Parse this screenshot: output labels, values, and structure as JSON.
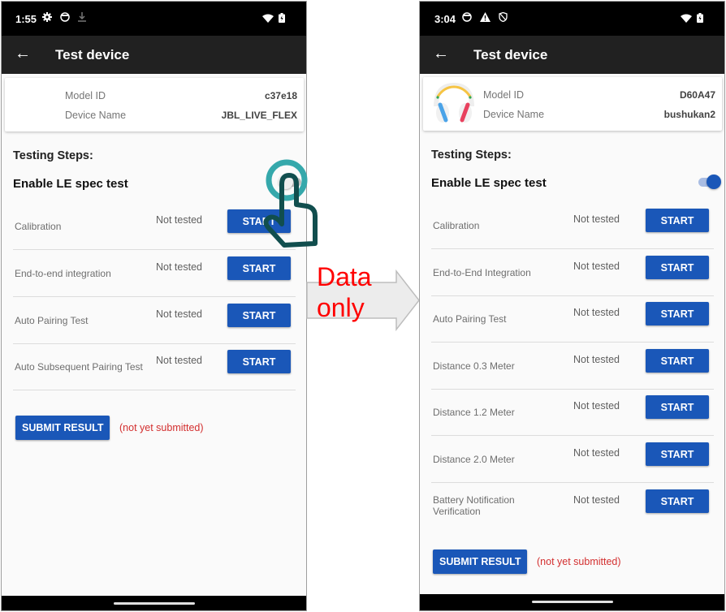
{
  "left_screen": {
    "status_bar": {
      "time": "1:55",
      "left_icons": [
        "settings-icon",
        "notification-app-icon",
        "download-icon"
      ],
      "right_icons": [
        "wifi-icon",
        "battery-charging-icon"
      ]
    },
    "app_bar": {
      "title": "Test device",
      "back_icon": "arrow-back-icon"
    },
    "device_card": {
      "model_id_label": "Model ID",
      "model_id_value": "c37e18",
      "device_name_label": "Device Name",
      "device_name_value": "JBL_LIVE_FLEX"
    },
    "section_title": "Testing Steps:",
    "le_spec_label": "Enable LE spec test",
    "le_spec_enabled": false,
    "tests": [
      {
        "name": "Calibration",
        "status": "Not tested",
        "button": "START"
      },
      {
        "name": "End-to-end integration",
        "status": "Not tested",
        "button": "START"
      },
      {
        "name": "Auto Pairing Test",
        "status": "Not tested",
        "button": "START"
      },
      {
        "name": "Auto Subsequent Pairing Test",
        "status": "Not tested",
        "button": "START"
      }
    ],
    "submit_button": "SUBMIT RESULT",
    "submit_status": "(not yet submitted)"
  },
  "annotation": {
    "arrow_text_line1": "Data",
    "arrow_text_line2": "only",
    "text_color": "#ff0000",
    "tap_indicator": "tap-hand-icon"
  },
  "right_screen": {
    "status_bar": {
      "time": "3:04",
      "left_icons": [
        "notification-app-icon",
        "warning-icon",
        "shield-icon"
      ],
      "right_icons": [
        "wifi-icon",
        "battery-charging-icon"
      ]
    },
    "app_bar": {
      "title": "Test device",
      "back_icon": "arrow-back-icon"
    },
    "device_card": {
      "image": "headphones-icon",
      "model_id_label": "Model ID",
      "model_id_value": "D60A47",
      "device_name_label": "Device Name",
      "device_name_value": "bushukan2"
    },
    "section_title": "Testing Steps:",
    "le_spec_label": "Enable LE spec test",
    "le_spec_enabled": true,
    "tests": [
      {
        "name": "Calibration",
        "status": "Not tested",
        "button": "START"
      },
      {
        "name": "End-to-End Integration",
        "status": "Not tested",
        "button": "START"
      },
      {
        "name": "Auto Pairing Test",
        "status": "Not tested",
        "button": "START"
      },
      {
        "name": "Distance 0.3 Meter",
        "status": "Not tested",
        "button": "START"
      },
      {
        "name": "Distance 1.2 Meter",
        "status": "Not tested",
        "button": "START"
      },
      {
        "name": "Distance 2.0 Meter",
        "status": "Not tested",
        "button": "START"
      },
      {
        "name": "Battery Notification Verification",
        "status": "Not tested",
        "button": "START"
      }
    ],
    "submit_button": "SUBMIT RESULT",
    "submit_status": "(not yet submitted)"
  },
  "colors": {
    "primary_button": "#1a57b8",
    "app_bar": "#212121",
    "status_bar": "#000000",
    "error_text": "#d32f2f",
    "background": "#fafafa"
  }
}
